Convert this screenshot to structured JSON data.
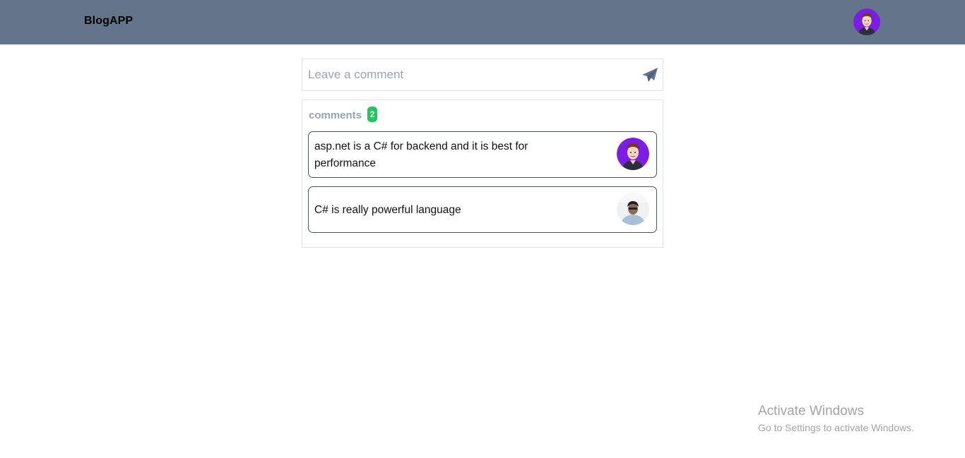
{
  "navbar": {
    "brand": "BlogAPP",
    "avatar_icon": "user-avatar-icon",
    "background_color": "#64748b"
  },
  "comment_form": {
    "placeholder": "Leave a comment",
    "value": "",
    "submit_icon": "paper-plane-icon"
  },
  "comments": {
    "title": "comments",
    "count": "2",
    "badge_color": "#22c55e",
    "items": [
      {
        "text": "asp.net is a C# for backend and it is best for performance",
        "avatar": "cartoon-avatar"
      },
      {
        "text": "C# is really powerful language",
        "avatar": "photo-avatar"
      }
    ]
  },
  "watermark": {
    "title": "Activate Windows",
    "subtitle": "Go to Settings to activate Windows."
  }
}
